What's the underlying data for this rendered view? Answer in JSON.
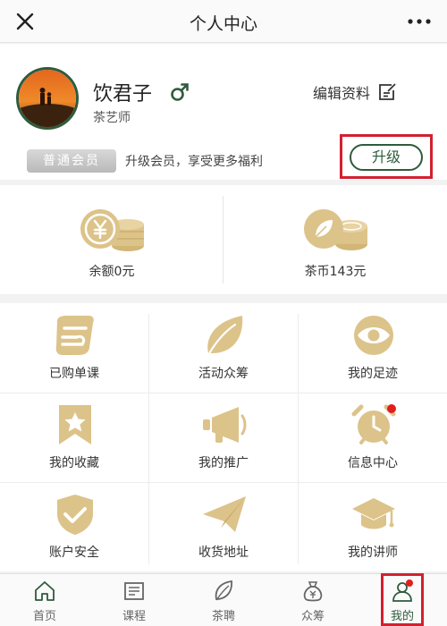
{
  "header": {
    "title": "个人中心"
  },
  "profile": {
    "username": "饮君子",
    "role": "茶艺师",
    "edit_label": "编辑资料",
    "member_badge": "普通会员",
    "member_text": "升级会员，享受更多福利",
    "upgrade_label": "升级"
  },
  "wallet": {
    "balance_label": "余额0元",
    "coins_label": "茶币143元"
  },
  "grid": {
    "items": [
      {
        "label": "已购单课",
        "icon": "purchased-course-icon"
      },
      {
        "label": "活动众筹",
        "icon": "leaf-icon"
      },
      {
        "label": "我的足迹",
        "icon": "eye-icon"
      },
      {
        "label": "我的收藏",
        "icon": "bookmark-star-icon"
      },
      {
        "label": "我的推广",
        "icon": "megaphone-icon"
      },
      {
        "label": "信息中心",
        "icon": "alarm-clock-icon"
      },
      {
        "label": "账户安全",
        "icon": "shield-check-icon"
      },
      {
        "label": "收货地址",
        "icon": "paper-plane-icon"
      },
      {
        "label": "我的讲师",
        "icon": "graduation-cap-icon"
      }
    ]
  },
  "tabbar": {
    "items": [
      {
        "label": "首页",
        "icon": "home-icon"
      },
      {
        "label": "课程",
        "icon": "course-icon"
      },
      {
        "label": "茶聘",
        "icon": "tea-leaf-icon"
      },
      {
        "label": "众筹",
        "icon": "money-bag-icon"
      },
      {
        "label": "我的",
        "icon": "user-icon"
      }
    ]
  },
  "colors": {
    "accent": "#2f5b3d",
    "icon_gold": "#dcc38a",
    "highlight_red": "#d2202f"
  }
}
